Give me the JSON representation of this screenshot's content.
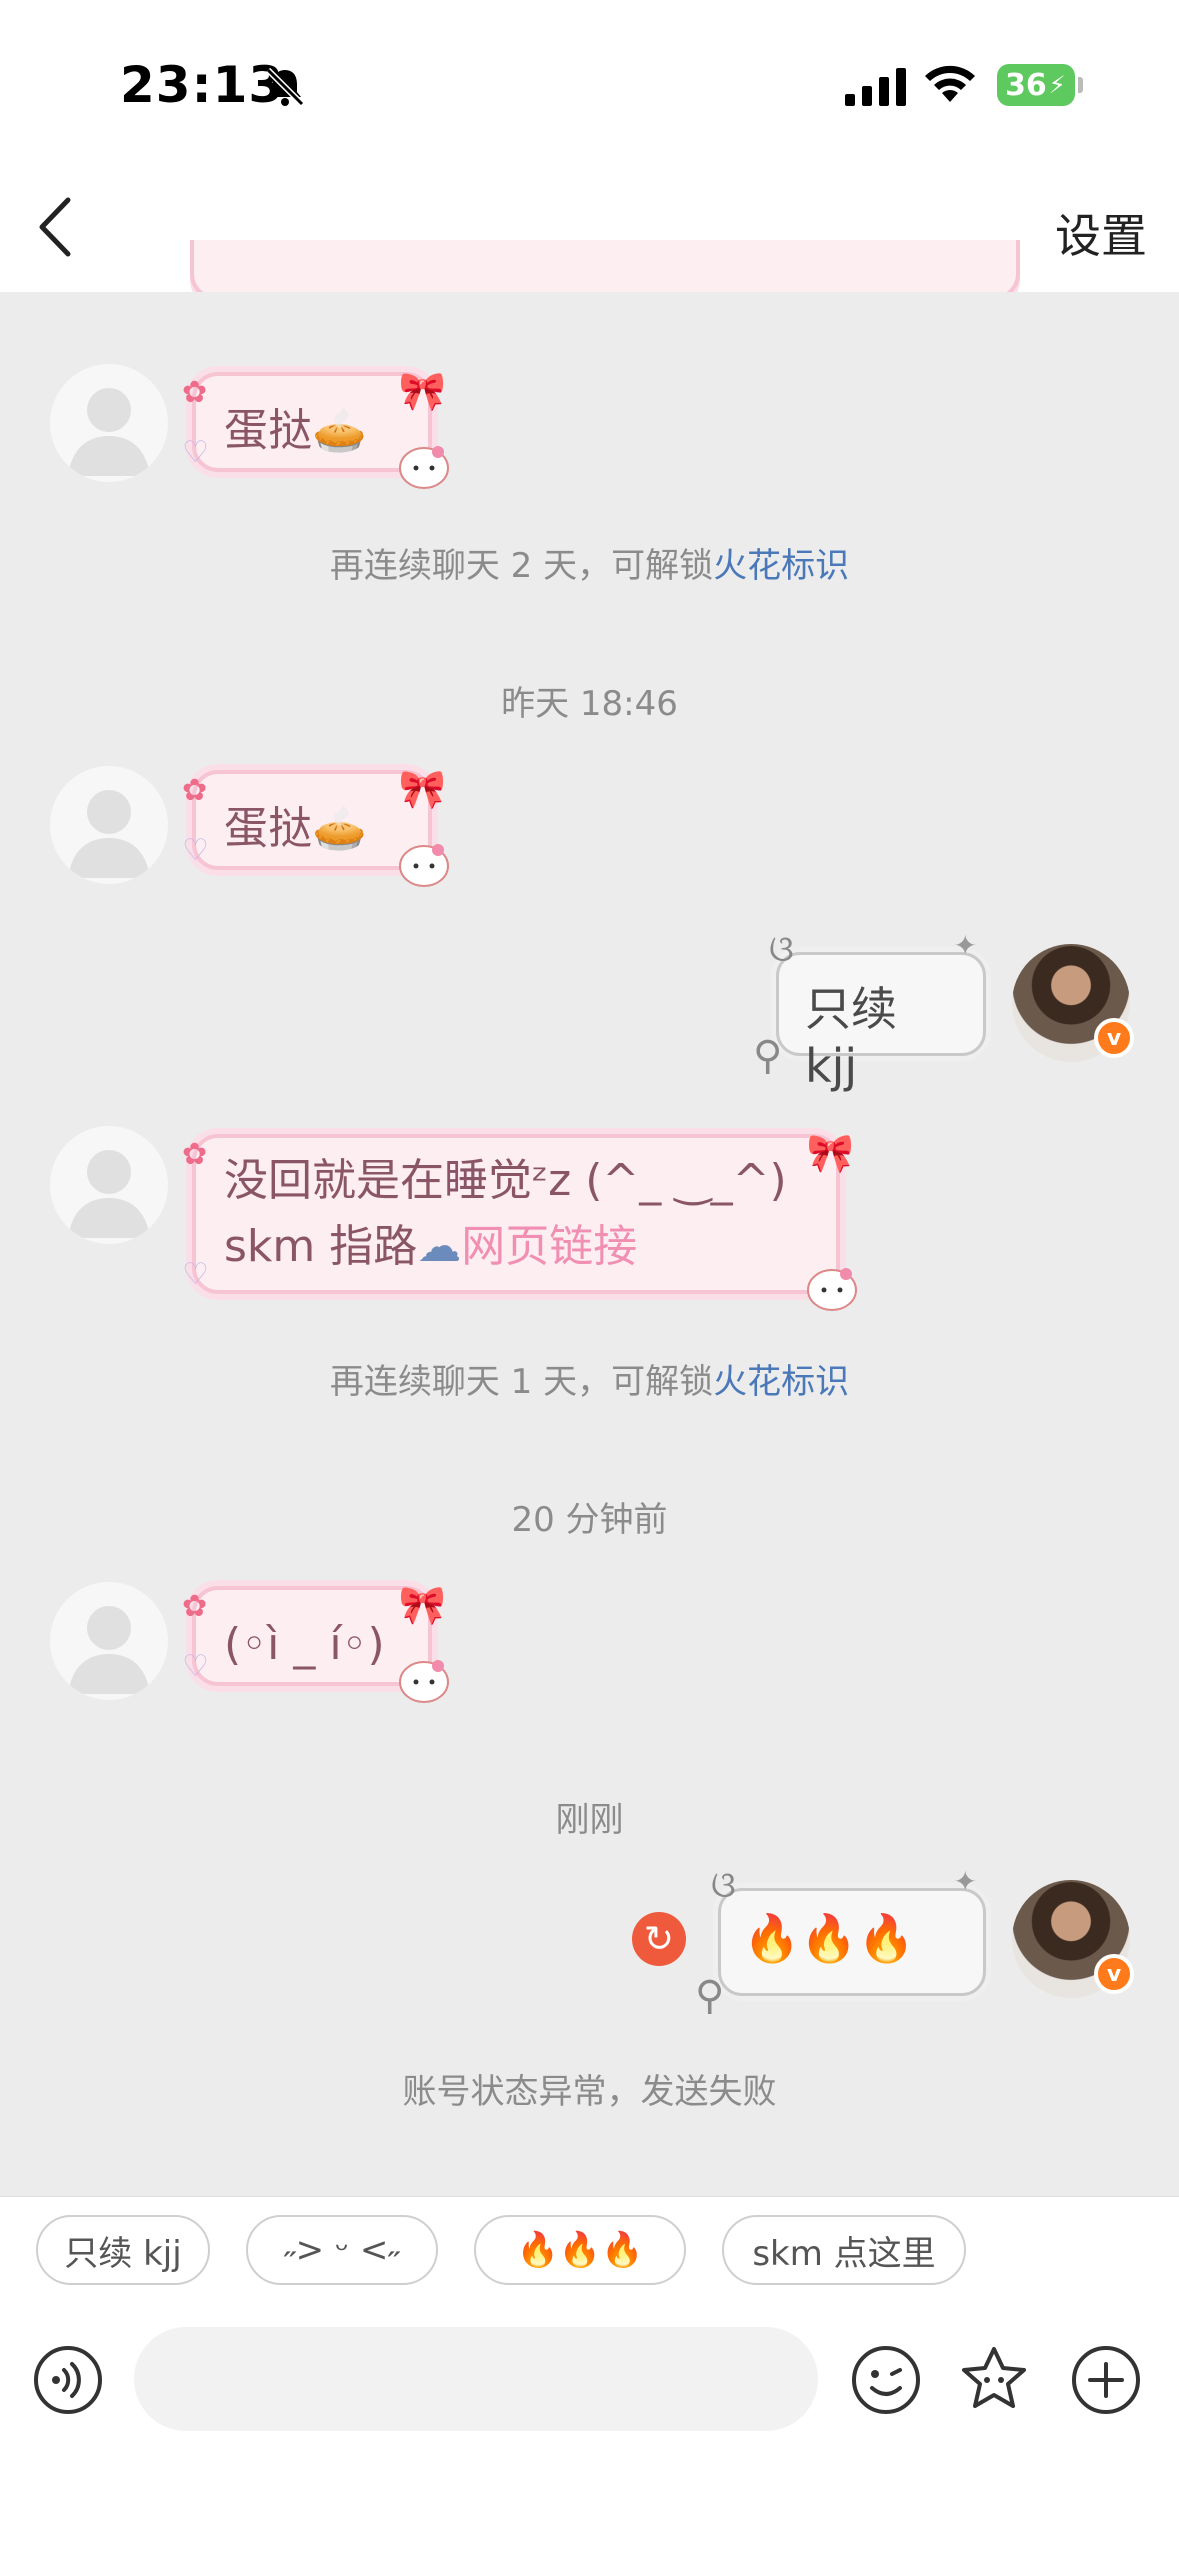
{
  "status_bar": {
    "time": "23:13",
    "battery": "36"
  },
  "header": {
    "back_icon": "chevron-left-icon",
    "settings_label": "设置"
  },
  "messages": {
    "m1": {
      "text": "蛋挞",
      "emoji": "🥧"
    },
    "sys1": {
      "prefix": "再连续聊天 2 天，可解锁",
      "highlight": "火花标识"
    },
    "time1": "昨天 18:46",
    "m2": {
      "text": "蛋挞",
      "emoji": "🥧"
    },
    "m3": {
      "text": "只续 kjj"
    },
    "m4": {
      "line1": "没回就是在睡觉ᶻz (^_ ‿_^)",
      "line2_prefix": "skm 指路",
      "link": "网页链接"
    },
    "sys2": {
      "prefix": "再连续聊天 1 天，可解锁",
      "highlight": "火花标识"
    },
    "time2": "20 分钟前",
    "m5": {
      "text": "(◦ì _ í◦)"
    },
    "time3": "刚刚",
    "m6": {
      "text": "🔥🔥🔥"
    },
    "error": "账号状态异常，发送失败"
  },
  "quick_replies": [
    "只续 kjj",
    "˶> ᵕ <˶",
    "🔥🔥🔥",
    "skm 点这里"
  ],
  "input": {
    "placeholder": ""
  },
  "toolbar_icons": [
    "voice-icon",
    "emoji-icon",
    "sticker-icon",
    "plus-icon"
  ],
  "colors": {
    "accent_blue": "#4a78b8",
    "bubble_pink": "#fdeef2",
    "error_red": "#ef5a3c",
    "verified_orange": "#ff7a1a"
  }
}
